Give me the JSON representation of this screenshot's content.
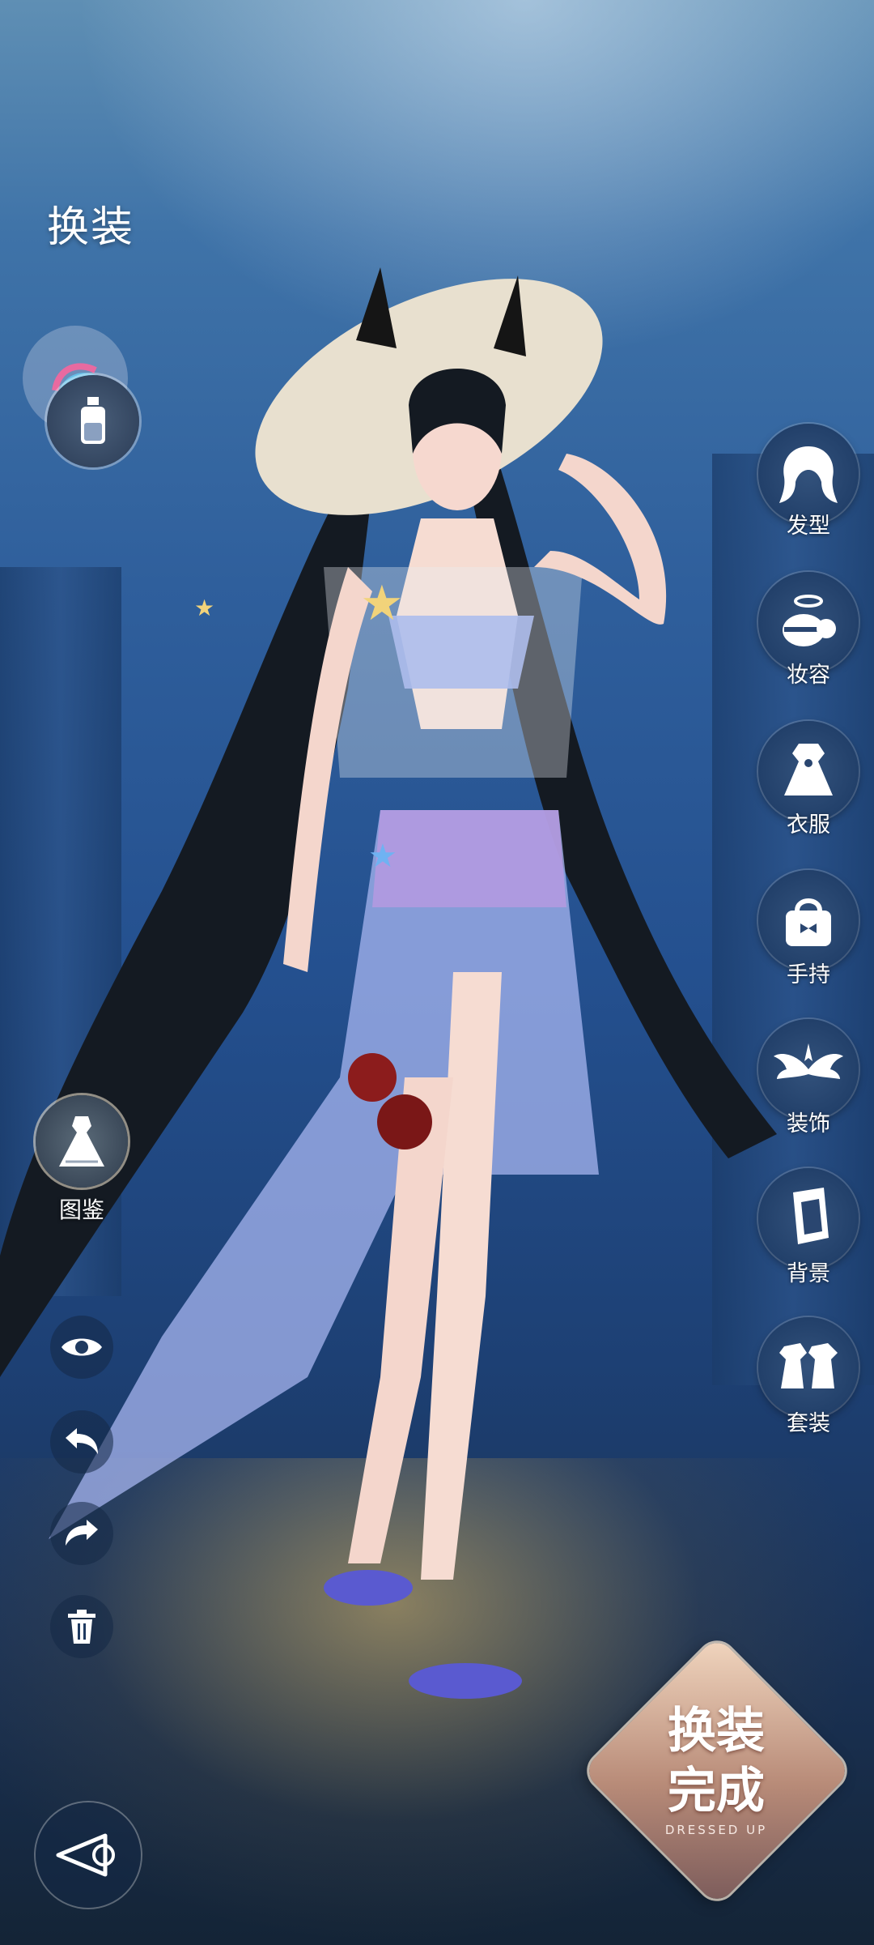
{
  "header": {
    "title": "换装"
  },
  "right_menu": [
    {
      "label": "发型"
    },
    {
      "label": "妆容"
    },
    {
      "label": "衣服"
    },
    {
      "label": "手持"
    },
    {
      "label": "装饰"
    },
    {
      "label": "背景"
    },
    {
      "label": "套装"
    }
  ],
  "left_menu": {
    "catalog_label": "图鉴"
  },
  "done_button": {
    "label_line1": "换装",
    "label_line2": "完成",
    "subtitle": "DRESSED UP"
  },
  "colors": {
    "accent": "#c9a08a",
    "water_top": "#5f8fb4",
    "water_deep": "#1d4074"
  }
}
